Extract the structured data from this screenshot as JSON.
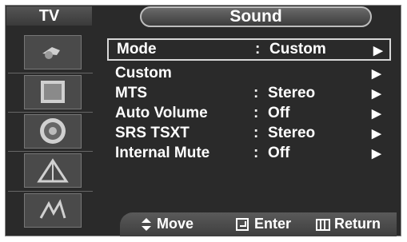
{
  "header": {
    "tv_label": "TV",
    "title": "Sound"
  },
  "sidebar": {
    "icons": [
      "input-icon",
      "picture-icon",
      "sound-icon",
      "channel-icon",
      "setup-icon"
    ]
  },
  "menu": {
    "items": [
      {
        "label": "Mode",
        "colon": ":",
        "value": "Custom",
        "arrow": "▶"
      },
      {
        "label": "Custom",
        "colon": "",
        "value": "",
        "arrow": "▶"
      },
      {
        "label": "MTS",
        "colon": ":",
        "value": "Stereo",
        "arrow": "▶"
      },
      {
        "label": "Auto Volume",
        "colon": ":",
        "value": "Off",
        "arrow": "▶"
      },
      {
        "label": "SRS TSXT",
        "colon": ":",
        "value": "Stereo",
        "arrow": "▶"
      },
      {
        "label": "Internal Mute",
        "colon": ":",
        "value": "Off",
        "arrow": "▶"
      }
    ]
  },
  "footer": {
    "move": "Move",
    "enter": "Enter",
    "return": "Return"
  },
  "colors": {
    "background": "#2a2a2a",
    "text": "#ffffff",
    "highlight_border": "#d8d8d8"
  }
}
